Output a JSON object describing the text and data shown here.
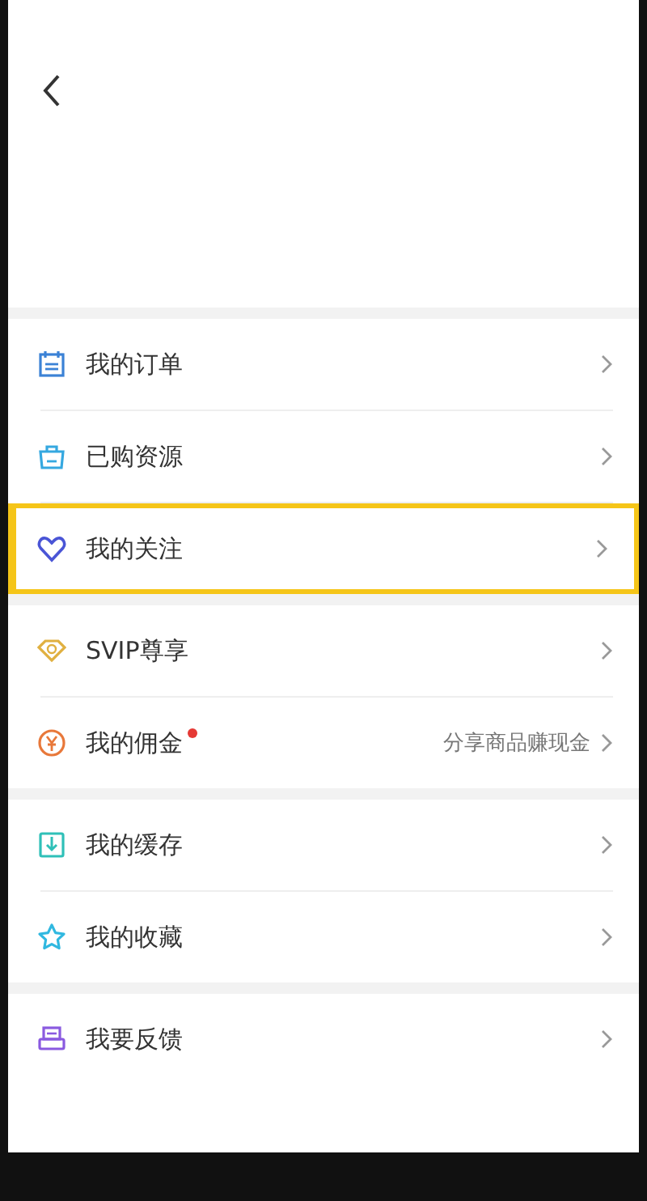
{
  "groups": [
    {
      "items": [
        {
          "kind": "calendar",
          "label": "我的订单",
          "highlighted": false,
          "badge_dot": false
        },
        {
          "kind": "bag",
          "label": "已购资源",
          "highlighted": false,
          "badge_dot": false
        },
        {
          "kind": "heart",
          "label": "我的关注",
          "highlighted": true,
          "badge_dot": false
        }
      ]
    },
    {
      "items": [
        {
          "kind": "diamond",
          "label": "SVIP尊享",
          "highlighted": false,
          "badge_dot": false
        },
        {
          "kind": "coin",
          "label": "我的佣金",
          "highlighted": false,
          "badge_dot": true,
          "hint": "分享商品赚现金"
        }
      ]
    },
    {
      "items": [
        {
          "kind": "download",
          "label": "我的缓存",
          "highlighted": false,
          "badge_dot": false
        },
        {
          "kind": "star",
          "label": "我的收藏",
          "highlighted": false,
          "badge_dot": false
        }
      ]
    },
    {
      "items": [
        {
          "kind": "printer",
          "label": "我要反馈",
          "highlighted": false,
          "badge_dot": false
        }
      ]
    }
  ]
}
